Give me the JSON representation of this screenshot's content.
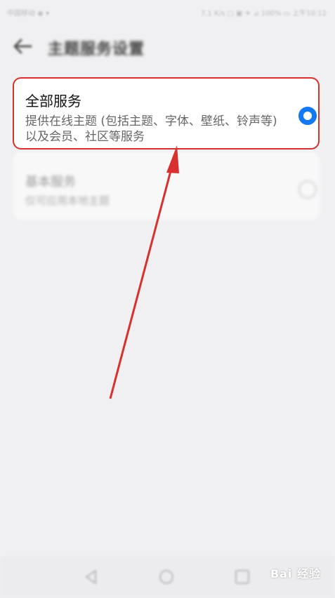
{
  "status_bar": {
    "left": "中国移动 ◉ ▾",
    "right": "7.1 K/s ▢ ▣ ✈ ⊿ 100% ▭ 上午10:12"
  },
  "header": {
    "title": "主题服务设置"
  },
  "options": [
    {
      "title": "全部服务",
      "description": "提供在线主题 (包括主题、字体、壁纸、铃声等) 以及会员、社区等服务",
      "selected": true
    },
    {
      "title": "基本服务",
      "description": "仅可应用本地主题",
      "selected": false
    }
  ],
  "watermark": {
    "text": "Bai 经验"
  },
  "colors": {
    "accent": "#1478f0",
    "annotation": "#d7302f"
  }
}
